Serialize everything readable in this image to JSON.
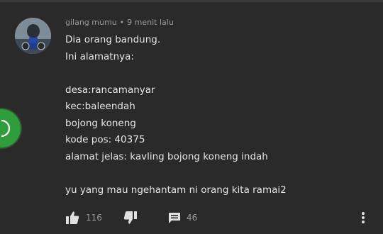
{
  "comment": {
    "author": "gilang mumu",
    "separator": "•",
    "time": "9 menit lalu",
    "lines": [
      "Dia orang bandung.",
      "Ini alamatnya:",
      "",
      "desa:rancamanyar",
      "kec:baleendah",
      "bojong koneng",
      "kode pos: 40375",
      "alamat jelas: kavling bojong koneng indah",
      "",
      "yu yang mau ngehantam ni orang kita ramai2"
    ]
  },
  "actions": {
    "like_count": "116",
    "reply_count": "46"
  },
  "icons": {
    "like": "thumbs-up-icon",
    "dislike": "thumbs-down-icon",
    "reply": "comment-icon",
    "more": "more-vertical-icon",
    "fab": "whatsapp-icon"
  },
  "colors": {
    "background": "#2a2a2a",
    "text": "#e6e6e6",
    "meta": "#9a9a9a",
    "fab": "#2f9e3a"
  }
}
